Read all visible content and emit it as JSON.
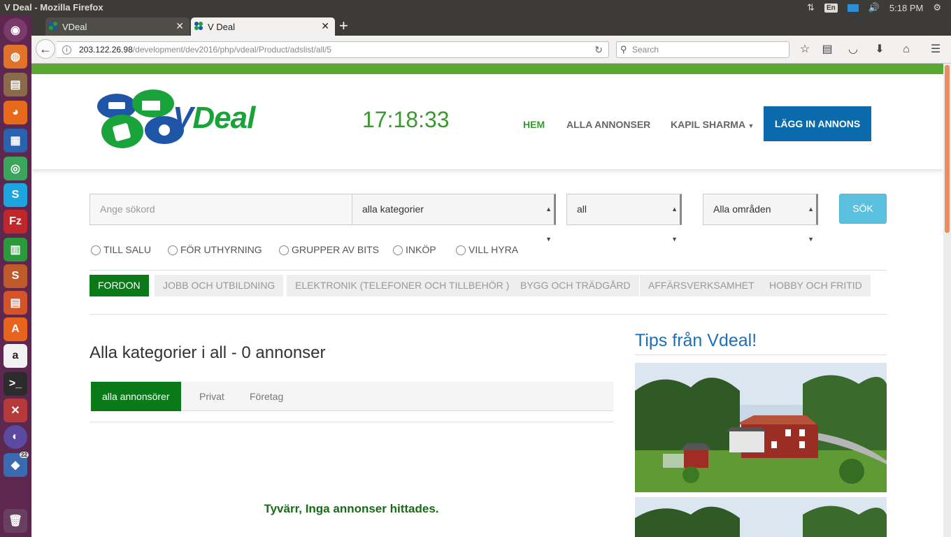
{
  "os": {
    "window_title": "V Deal - Mozilla Firefox",
    "keyboard_layout": "En",
    "time": "5:18 PM",
    "launcher_badge": "22"
  },
  "browser": {
    "tabs": [
      {
        "label": "VDeal",
        "active": false
      },
      {
        "label": "V Deal",
        "active": true
      }
    ],
    "url_host": "203.122.26.98",
    "url_path": "/development/dev2016/php/vdeal/Product/adslist/all/5",
    "search_placeholder": "Search"
  },
  "site": {
    "logo_text_a": "V",
    "logo_text_b": "Deal",
    "clock": "17:18:33",
    "menu": {
      "home": "HEM",
      "all_ads": "ALLA ANNONSER",
      "user": "KAPIL SHARMA",
      "post_ad": "LÄGG IN ANNONS"
    },
    "search": {
      "keyword_placeholder": "Ange sökord",
      "category": "alla kategorier",
      "region": "all",
      "area": "Alla områden",
      "button": "SÖK"
    },
    "ad_types": [
      "TILL SALU",
      "FÖR UTHYRNING",
      "GRUPPER AV BITS",
      "INKÖP",
      "VILL HYRA"
    ],
    "categories": [
      "FORDON",
      "JOBB OCH UTBILDNING",
      "ELEKTRONIK (TELEFONER OCH TILLBEHÖR )",
      "BYGG OCH TRÄDGÅRD",
      "AFFÄRSVERKSAMHET",
      "HOBBY OCH FRITID"
    ],
    "listing_title": "Alla kategorier i all - 0 annonser",
    "advertiser_tabs": [
      "alla annonsörer",
      "Privat",
      "Företag"
    ],
    "no_results": "Tyvärr, Inga annonser hittades.",
    "tips_title": "Tips från Vdeal!"
  },
  "colors": {
    "brand_green": "#5aa832",
    "active_green": "#0a7a19",
    "primary_blue": "#0a6aab",
    "search_button": "#5bc0de"
  }
}
